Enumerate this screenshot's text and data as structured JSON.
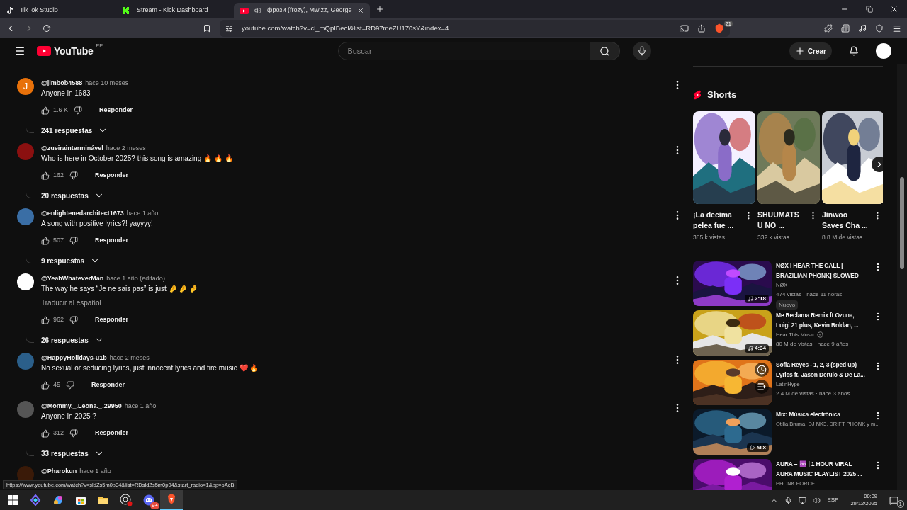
{
  "browser": {
    "tabs": [
      {
        "title": "TikTok Studio",
        "kind": "tiktok",
        "selected": false,
        "audio": false
      },
      {
        "title": "Stream - Kick Dashboard",
        "kind": "kick",
        "selected": false,
        "audio": false
      },
      {
        "title": "фрози (frozy), Mwizz, George",
        "kind": "youtube",
        "selected": true,
        "audio": true
      }
    ],
    "url": "youtube.com/watch?v=cl_mQpIBecI&list=RD97meZU170sY&index=4",
    "shield_count": "21"
  },
  "header": {
    "logo": "YouTube",
    "region": "PE",
    "search": {
      "placeholder": "Buscar"
    },
    "create": "Crear"
  },
  "comments": [
    {
      "author": "@jimbob4588",
      "time": "hace 10 meses",
      "text": "Anyone in 1683",
      "likes": "1.6 K",
      "reply": "Responder",
      "replies": "241 respuestas",
      "avatar": {
        "letter": "J",
        "color": "#e8710a"
      }
    },
    {
      "author": "@zueirainterminável",
      "time": "hace 2 meses",
      "text": "Who is here in October 2025? this song is amazing 🔥 🔥 🔥",
      "likes": "162",
      "reply": "Responder",
      "replies": "20 respuestas",
      "avatar": {
        "color": "#8b1010"
      }
    },
    {
      "author": "@enlightenedarchitect1673",
      "time": "hace 1 año",
      "text": "A song with positive lyrics?! yayyyy!",
      "likes": "507",
      "reply": "Responder",
      "replies": "9 respuestas",
      "avatar": {
        "color": "#3a6ea5"
      }
    },
    {
      "author": "@YeahWhateverMan",
      "time": "hace 1 año (editado)",
      "text": "The way he says “Je ne sais pas” is just 🤌 🤌 🤌",
      "translate": "Traducir al español",
      "likes": "962",
      "reply": "Responder",
      "replies": "26 respuestas",
      "avatar": {
        "color": "#ffffff"
      }
    },
    {
      "author": "@HappyHolidays-u1b",
      "time": "hace 2 meses",
      "text": "No sexual or seducing lyrics, just innocent lyrics and fire music ❤️ 🔥",
      "likes": "45",
      "reply": "Responder",
      "avatar": {
        "color": "#2b5f8a"
      }
    },
    {
      "author": "@Mommy._.Leona._.29950",
      "time": "hace 1 año",
      "text": "Anyone in 2025 ?",
      "likes": "312",
      "reply": "Responder",
      "replies": "33 respuestas",
      "avatar": {
        "color": "#555555"
      }
    },
    {
      "author": "@Pharokun",
      "time": "hace 1 año",
      "avatar": {
        "color": "#3a1a08"
      }
    }
  ],
  "shorts": {
    "title": "Shorts",
    "items": [
      {
        "title": "¡La decima pelea fue ...",
        "views": "385 k vistas"
      },
      {
        "title": "SHUUMATSU NO ...",
        "views": "332 k vistas"
      },
      {
        "title": "Jinwoo Saves Cha ...",
        "views": "8.8 M de vistas"
      }
    ]
  },
  "videos": [
    {
      "title": "NØX I HEAR THE CALL [ BRAZILIAN PHONK]  SLOWED",
      "channel": "NØX",
      "verified": false,
      "meta": "474 vistas · hace 11 horas",
      "badge": "Nuevo",
      "duration": "2:18",
      "kind": "music",
      "hovered": false
    },
    {
      "title": "Me Reclama Remix ft Ozuna, Luigi 21 plus, Kevin Roldan, ...",
      "channel": "Hear This Music",
      "verified": true,
      "meta": "80 M de vistas · hace 9 años",
      "duration": "4:34",
      "kind": "music",
      "hovered": false
    },
    {
      "title": "Sofia Reyes - 1, 2, 3 (sped up) Lyrics ft. Jason Derulo & De La...",
      "channel": "LatinHype",
      "verified": false,
      "meta": "2.4 M de vistas · hace 3 años",
      "hovered": true
    },
    {
      "title": "Mix: Música electrónica",
      "channel": "Otilia Bruma, DJ NK3, DRIFT PHONK y m...",
      "verified": false,
      "duration": "Mix",
      "kind": "mix",
      "hovered": false
    },
    {
      "title": "AURA = ♾️ | 1 HOUR VIRAL AURA MUSIC PLAYLIST 2025 ...",
      "channel": "PHONK FORCE",
      "verified": false,
      "hovered": false
    }
  ],
  "status_url": "https://www.youtube.com/watch?v=sldZs5m0p04&list=RDsldZs5m0p04&start_radio=1&pp=oAcB",
  "taskbar": {
    "apps": [
      {
        "kind": "windows",
        "active": false
      },
      {
        "kind": "studio",
        "active": false
      },
      {
        "kind": "copilot",
        "active": false
      },
      {
        "kind": "store",
        "active": false
      },
      {
        "kind": "files",
        "active": false
      },
      {
        "kind": "obs",
        "active": false
      },
      {
        "kind": "discord",
        "active": false,
        "badge": "9+"
      },
      {
        "kind": "brave",
        "active": true
      }
    ],
    "language": "ESP",
    "time": "00:09",
    "date": "29/12/2025",
    "notifications": "1"
  }
}
